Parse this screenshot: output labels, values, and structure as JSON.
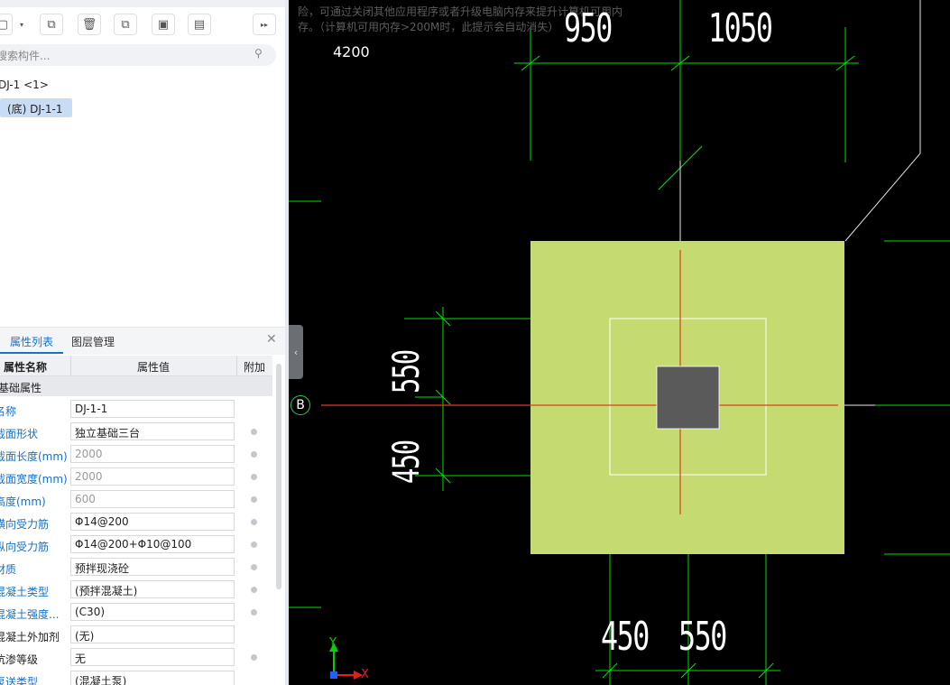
{
  "toolbar": {
    "more": "▸▸"
  },
  "search": {
    "placeholder": "搜索构件..."
  },
  "tree": {
    "parent": "DJ-1 <1>",
    "child": "(底) DJ-1-1"
  },
  "panel": {
    "tab_properties": "属性列表",
    "tab_layers": "图层管理",
    "col_name": "属性名称",
    "col_value": "属性值",
    "col_extra": "附加",
    "group": "基础属性",
    "rows": [
      {
        "name": "名称",
        "value": "DJ-1-1"
      },
      {
        "name": "截面形状",
        "value": "独立基础三台"
      },
      {
        "name": "截面长度(mm)",
        "value": "2000"
      },
      {
        "name": "截面宽度(mm)",
        "value": "2000"
      },
      {
        "name": "高度(mm)",
        "value": "600"
      },
      {
        "name": "横向受力筋",
        "value": "Φ14@200"
      },
      {
        "name": "纵向受力筋",
        "value": "Φ14@200+Φ10@100"
      },
      {
        "name": "材质",
        "value": "预拌现浇砼"
      },
      {
        "name": "混凝土类型",
        "value": "(预拌混凝土)"
      },
      {
        "name": "混凝土强度...",
        "value": "(C30)"
      },
      {
        "name": "混凝土外加剂",
        "value": "(无)"
      },
      {
        "name": "抗渗等级",
        "value": "无"
      },
      {
        "name": "泵送类型",
        "value": "(混凝土泵)"
      }
    ]
  },
  "canvas": {
    "message_line1": "险，可通过关闭其他应用程序或者升级电脑内存来提升计算机可用内",
    "message_line2": "存。（计算机可用内存>200M时，此提示会自动消失）",
    "label_4200": "4200",
    "dim_top_left": "950",
    "dim_top_right": "1050",
    "dim_left_a": "550",
    "dim_left_b": "450",
    "dim_bottom_a": "450",
    "dim_bottom_b": "550",
    "axis_label": "B",
    "ucs_x": "X",
    "ucs_y": "Y"
  },
  "colors": {
    "pad": "#c5db72",
    "column": "#5a5a5a",
    "dimline": "#00e000",
    "axis": "#e03c1c"
  }
}
